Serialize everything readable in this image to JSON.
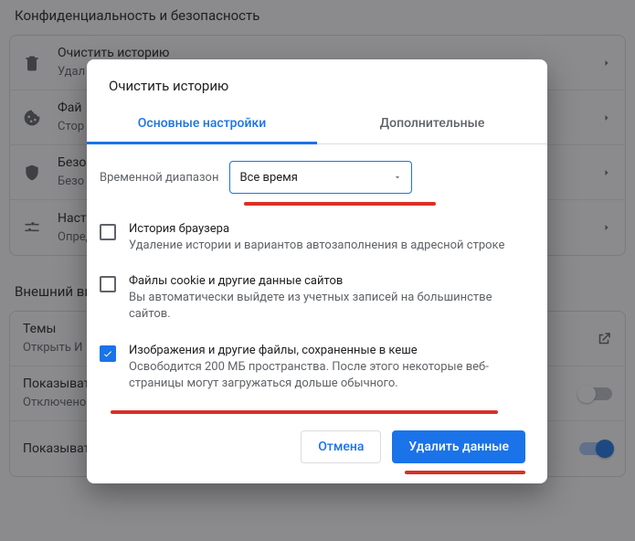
{
  "sections": {
    "privacy_title": "Конфиденциальность и безопасность",
    "appearance_title": "Внешний вид"
  },
  "privacy_rows": [
    {
      "title": "Очистить историю",
      "sub": "Удал"
    },
    {
      "title": "Фай",
      "sub": "Стор"
    },
    {
      "title": "Безо",
      "sub": "Безо"
    },
    {
      "title": "Наст",
      "sub": "Определ ли у окон"
    }
  ],
  "appearance_rows": {
    "themes": {
      "title": "Темы",
      "sub": "Открыть И"
    },
    "homebtn": {
      "title": "Показыват",
      "sub": "Отключено"
    },
    "bookmarks_bar": "Показывать панель закладок"
  },
  "dialog": {
    "title": "Очистить историю",
    "tabs": {
      "basic": "Основные настройки",
      "advanced": "Дополнительные"
    },
    "range_label": "Временной диапазон",
    "range_value": "Все время",
    "items": {
      "history": {
        "title": "История браузера",
        "desc": "Удаление истории и вариантов автозаполнения в адресной строке",
        "checked": false
      },
      "cookies": {
        "title": "Файлы cookie и другие данные сайтов",
        "desc": "Вы автоматически выйдете из учетных записей на большинстве сайтов.",
        "checked": false
      },
      "cache": {
        "title": "Изображения и другие файлы, сохраненные в кеше",
        "desc": "Освободится 200 МБ пространства. После этого некоторые веб-страницы могут загружаться дольше обычного.",
        "checked": true
      }
    },
    "buttons": {
      "cancel": "Отмена",
      "confirm": "Удалить данные"
    }
  }
}
